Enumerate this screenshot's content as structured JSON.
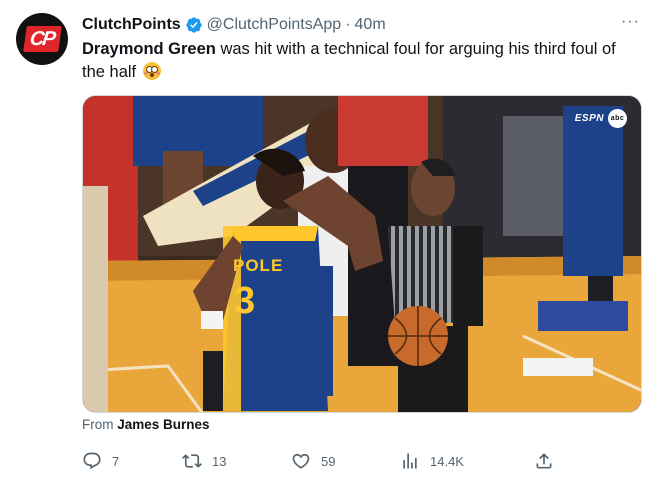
{
  "author": {
    "display_name": "ClutchPoints",
    "handle": "@ClutchPointsApp",
    "separator": "·",
    "time": "40m",
    "avatar_text": "CP",
    "verified": true
  },
  "menu": {
    "more_label": "···"
  },
  "tweet": {
    "bold_text": "Draymond Green",
    "text": " was hit with a technical foul for arguing his third foul of the half",
    "emoji": "flushed-face"
  },
  "media": {
    "jersey_name": "POLE",
    "jersey_number": "3",
    "network_logo": "ESPN",
    "network_logo_2": "abc"
  },
  "attribution": {
    "prefix": "From",
    "name": "James Burnes"
  },
  "actions": {
    "reply_count": "7",
    "retweet_count": "13",
    "like_count": "59",
    "views_count": "14.4K"
  },
  "colors": {
    "text_primary": "#0f1419",
    "text_secondary": "#536471",
    "verified_blue": "#1d9bf0",
    "brand_red": "#e0262b",
    "court": "#e9a63a",
    "warriors_blue": "#1d428a",
    "warriors_gold": "#ffc72c"
  }
}
